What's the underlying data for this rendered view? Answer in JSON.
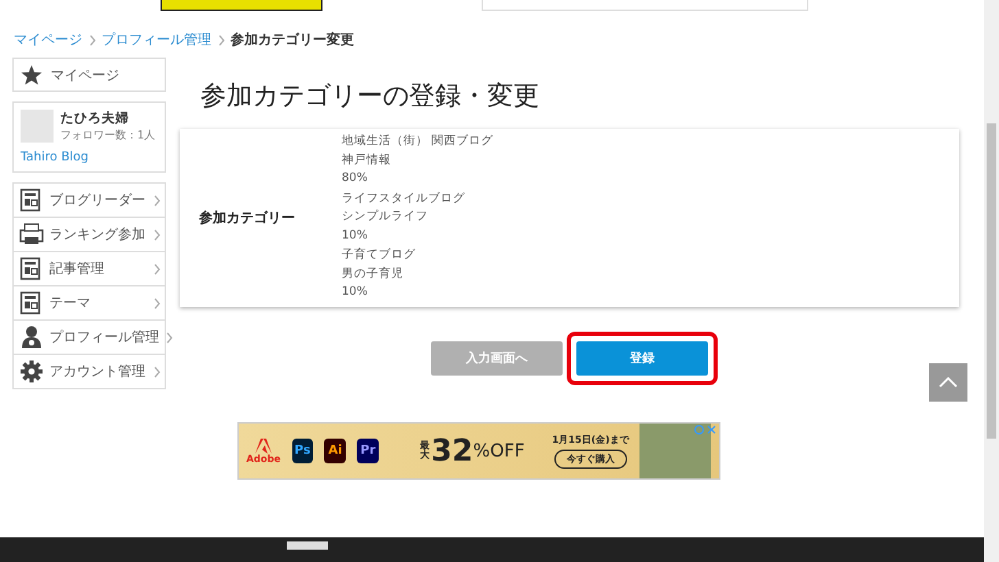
{
  "breadcrumb": [
    {
      "label": "マイページ",
      "link": true
    },
    {
      "label": "プロフィール管理",
      "link": true
    },
    {
      "label": "参加カテゴリー変更",
      "link": false
    }
  ],
  "sidebar": {
    "mypage": "マイページ",
    "profile": {
      "name": "たひろ夫婦",
      "followers": "フォロワー数：1人",
      "blog": "Tahiro Blog"
    },
    "items": [
      {
        "label": "ブログリーダー",
        "kind": "doc"
      },
      {
        "label": "ランキング参加",
        "kind": "printer"
      },
      {
        "label": "記事管理",
        "kind": "doc"
      },
      {
        "label": "テーマ",
        "kind": "doc"
      },
      {
        "label": "プロフィール管理",
        "kind": "person"
      },
      {
        "label": "アカウント管理",
        "kind": "gear"
      }
    ]
  },
  "page_title": "参加カテゴリーの登録・変更",
  "form": {
    "label": "参加カテゴリー",
    "categories": [
      {
        "genre": "地域生活（街） 関西ブログ",
        "sub": "神戸情報",
        "share": "80%"
      },
      {
        "genre": "ライフスタイルブログ",
        "sub": "シンプルライフ",
        "share": "10%"
      },
      {
        "genre": "子育てブログ",
        "sub": "男の子育児",
        "share": "10%"
      }
    ]
  },
  "buttons": [
    {
      "label": "入力画面へ",
      "kind": "back",
      "highlighted": false
    },
    {
      "label": "登録",
      "kind": "submit",
      "highlighted": true
    }
  ],
  "ad": {
    "brand": "Adobe",
    "apps": [
      "Ps",
      "Ai",
      "Pr"
    ],
    "prefix": "最大",
    "discount": "32",
    "suffix": "%OFF",
    "deadline": "1月15日(金)まで",
    "cta": "今すぐ購入"
  }
}
